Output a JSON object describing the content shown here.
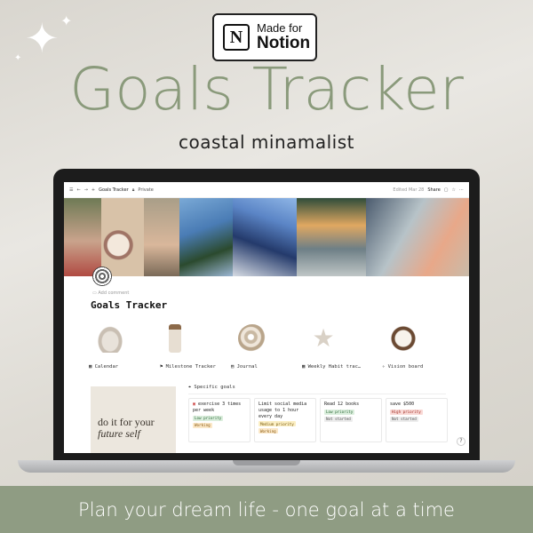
{
  "badge": {
    "made_for": "Made for",
    "product": "Notion",
    "logo_letter": "N"
  },
  "headline": "Goals Tracker",
  "subhead": "coastal minamalist",
  "colors": {
    "sage": "#8a9a7b",
    "banner": "#8f9c83"
  },
  "app": {
    "breadcrumb_title": "Goals Tracker",
    "breadcrumb_sub": "Private",
    "edited_label": "Edited Mar 28",
    "share_label": "Share",
    "add_comment": "Add comment",
    "page_title": "Goals Tracker",
    "gallery": [
      {
        "label": "Calendar",
        "icon": "calendar-icon"
      },
      {
        "label": "Milestone Tracker",
        "icon": "flag-icon"
      },
      {
        "label": "Journal",
        "icon": "book-icon"
      },
      {
        "label": "Weekly Habit trac…",
        "icon": "table-icon"
      },
      {
        "label": "Vision board",
        "icon": "sparkle-icon"
      }
    ],
    "quote_line1": "do it for your",
    "quote_line2": "future self",
    "specific_goals_label": "Specific goals",
    "goals": [
      {
        "title": "exercise 3 times per week",
        "priority": "Low priority",
        "status": "Working"
      },
      {
        "title": "Limit social media usage to 1 hour every day",
        "priority": "Medium priority",
        "status": "Working"
      },
      {
        "title": "Read 12 books",
        "priority": "Low priority",
        "status": "Not started"
      },
      {
        "title": "save $500",
        "priority": "High priority",
        "status": "Not started"
      }
    ],
    "help": "?"
  },
  "banner": "Plan your dream life - one goal at a time"
}
